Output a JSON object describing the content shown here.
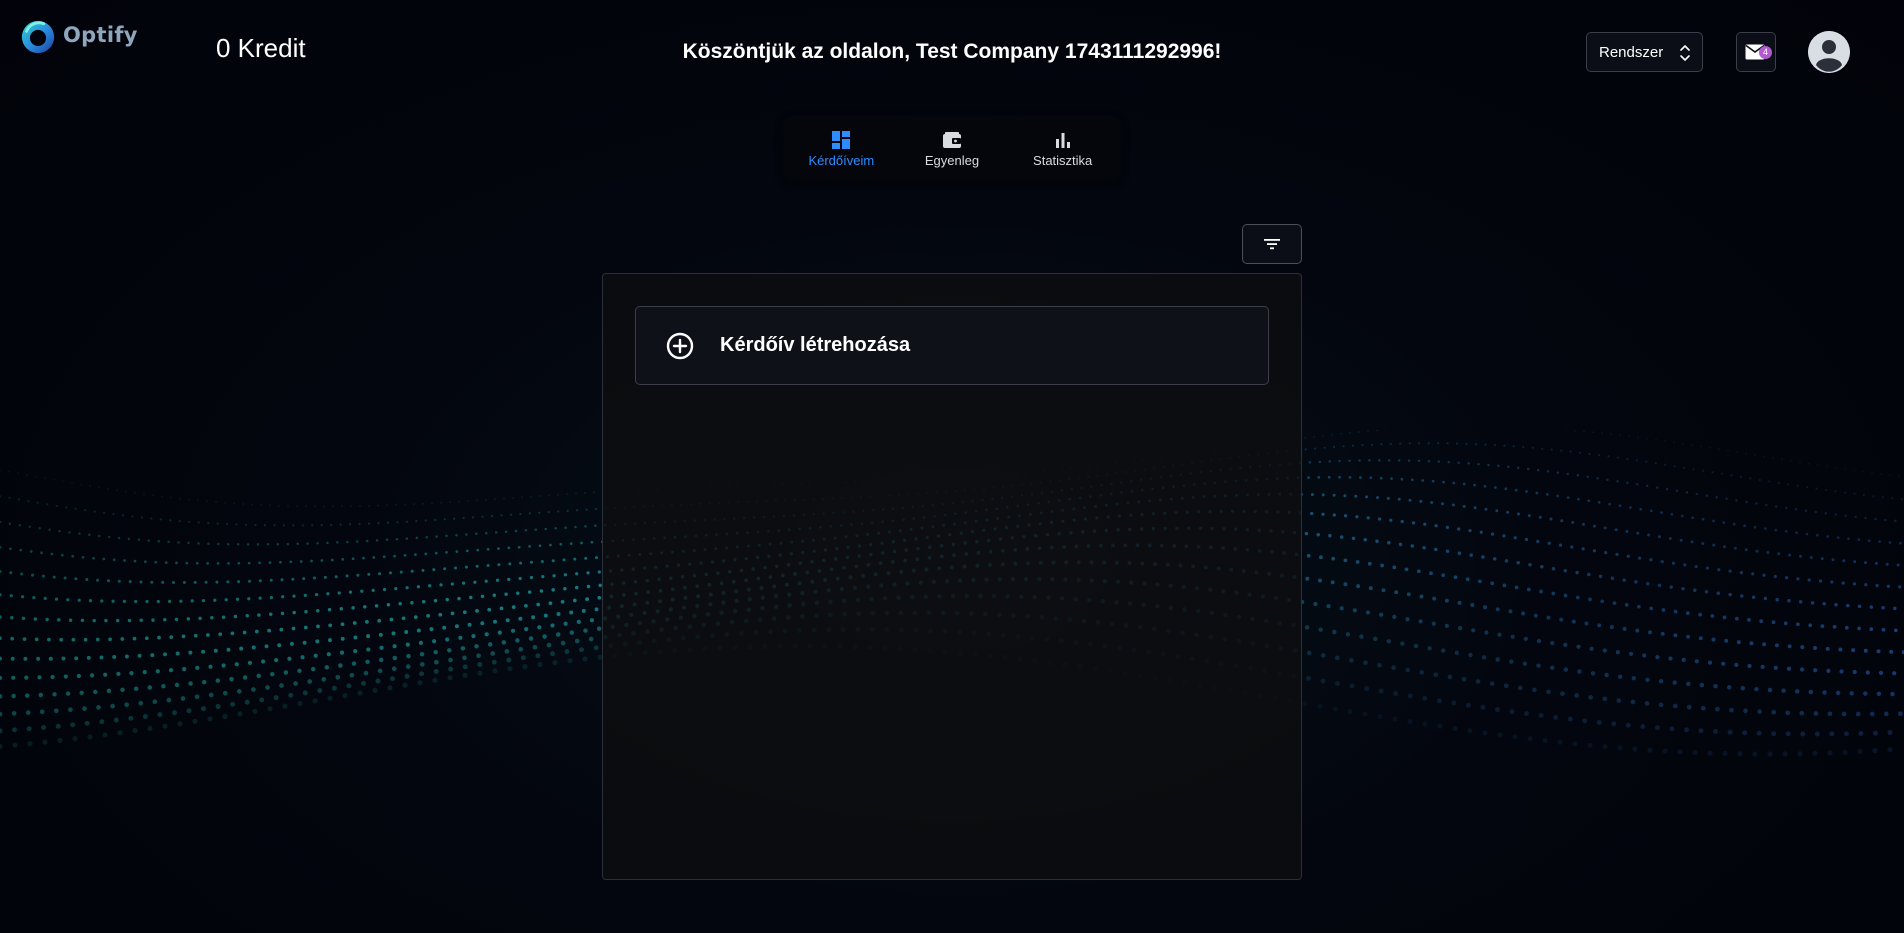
{
  "brand": {
    "name": "Optify",
    "accent": "#2f8cff",
    "wave_colors": [
      "#1fb3a8",
      "#2f6fd6"
    ]
  },
  "header": {
    "credit": "0 Kredit",
    "welcome": "Köszöntjük az oldalon, Test Company 1743111292996!",
    "theme_select": {
      "value": "Rendszer",
      "icon": "chevron-up-down-icon"
    },
    "mail": {
      "icon": "mail-icon",
      "badge": "4",
      "badge_color": "#b35ad1"
    },
    "avatar": {
      "icon": "user-icon"
    }
  },
  "tabs": [
    {
      "label": "Kérdőíveim",
      "icon": "dashboard-icon",
      "active": true
    },
    {
      "label": "Egyenleg",
      "icon": "wallet-icon",
      "active": false
    },
    {
      "label": "Statisztika",
      "icon": "bar-chart-icon",
      "active": false
    }
  ],
  "toolbar": {
    "filter_icon": "filter-icon"
  },
  "main": {
    "create_label": "Kérdőív létrehozása",
    "create_icon": "plus-circle-icon"
  }
}
